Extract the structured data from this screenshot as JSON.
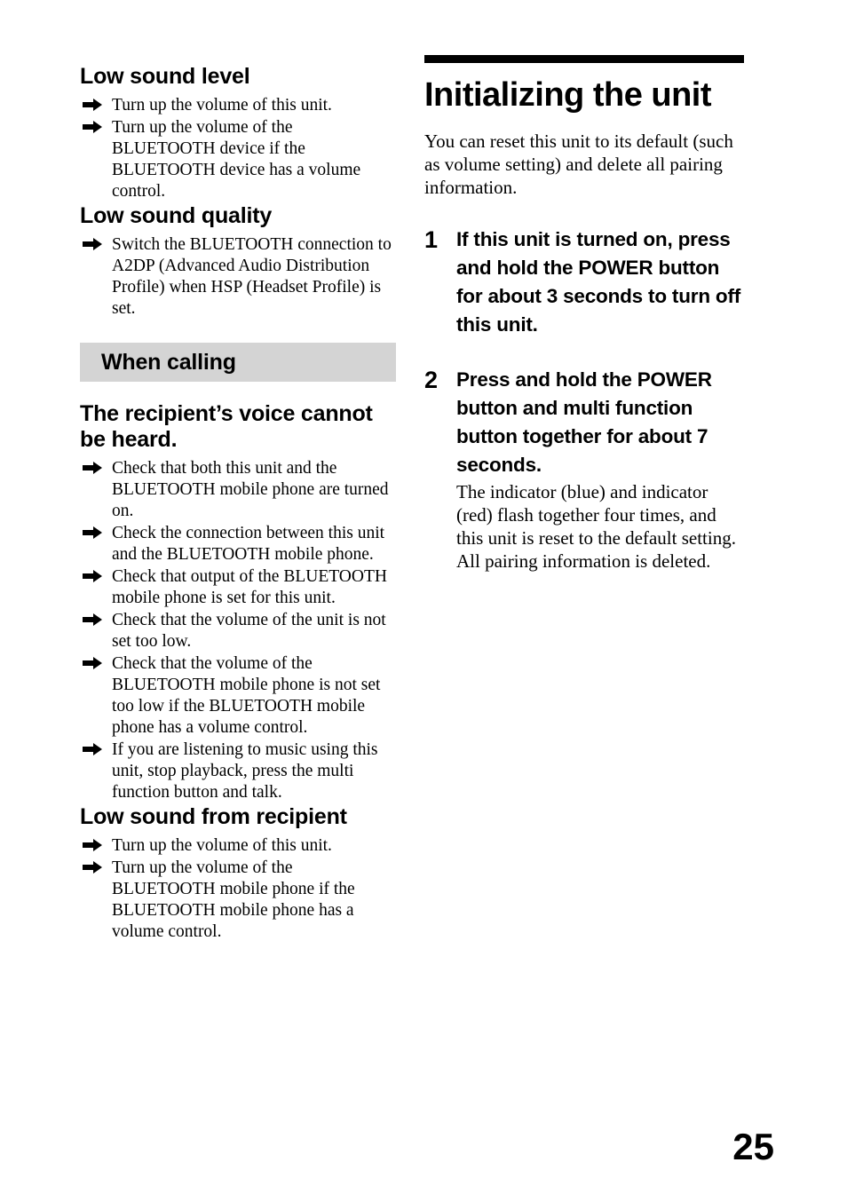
{
  "left_column": {
    "sections": [
      {
        "heading": "Low sound level",
        "items": [
          "Turn up the volume of this unit.",
          "Turn up the volume of the BLUETOOTH device if the BLUETOOTH device has a volume control."
        ]
      },
      {
        "heading": "Low sound quality",
        "items": [
          "Switch the BLUETOOTH connection to A2DP (Advanced Audio Distribution Profile) when HSP (Headset Profile) is set."
        ]
      }
    ],
    "banner": "When calling",
    "sections2": [
      {
        "heading": "The recipient’s voice cannot be heard.",
        "items": [
          "Check that both this unit and the BLUETOOTH mobile phone are turned on.",
          "Check the connection between this unit and the BLUETOOTH mobile phone.",
          "Check that output of the BLUETOOTH mobile phone is set for this unit.",
          "Check that the volume of the unit is not set too low.",
          "Check that the volume of the BLUETOOTH mobile phone is not set too low if the BLUETOOTH mobile phone has a volume control.",
          "If you are listening to music using this unit, stop playback, press the multi function button and talk."
        ]
      },
      {
        "heading": "Low sound from recipient",
        "items": [
          "Turn up the volume of this unit.",
          "Turn up the volume of the BLUETOOTH mobile phone if the BLUETOOTH mobile phone has a volume control."
        ]
      }
    ]
  },
  "right_column": {
    "chapter_title": "Initializing the unit",
    "intro": "You can reset this unit to its default (such as volume setting) and delete all pairing information.",
    "steps": [
      {
        "number": "1",
        "heading": "If this unit is turned on, press and hold the POWER button for about 3 seconds to turn off this unit.",
        "sub": ""
      },
      {
        "number": "2",
        "heading": "Press and hold the POWER button and multi function button together for about 7 seconds.",
        "sub": "The indicator (blue) and indicator (red) flash together four times, and this unit is reset to the default setting. All pairing information is deleted."
      }
    ]
  },
  "page_number": "25",
  "colors": {
    "banner_background": "#d4d4d4",
    "rule": "#000000",
    "text": "#000000"
  }
}
